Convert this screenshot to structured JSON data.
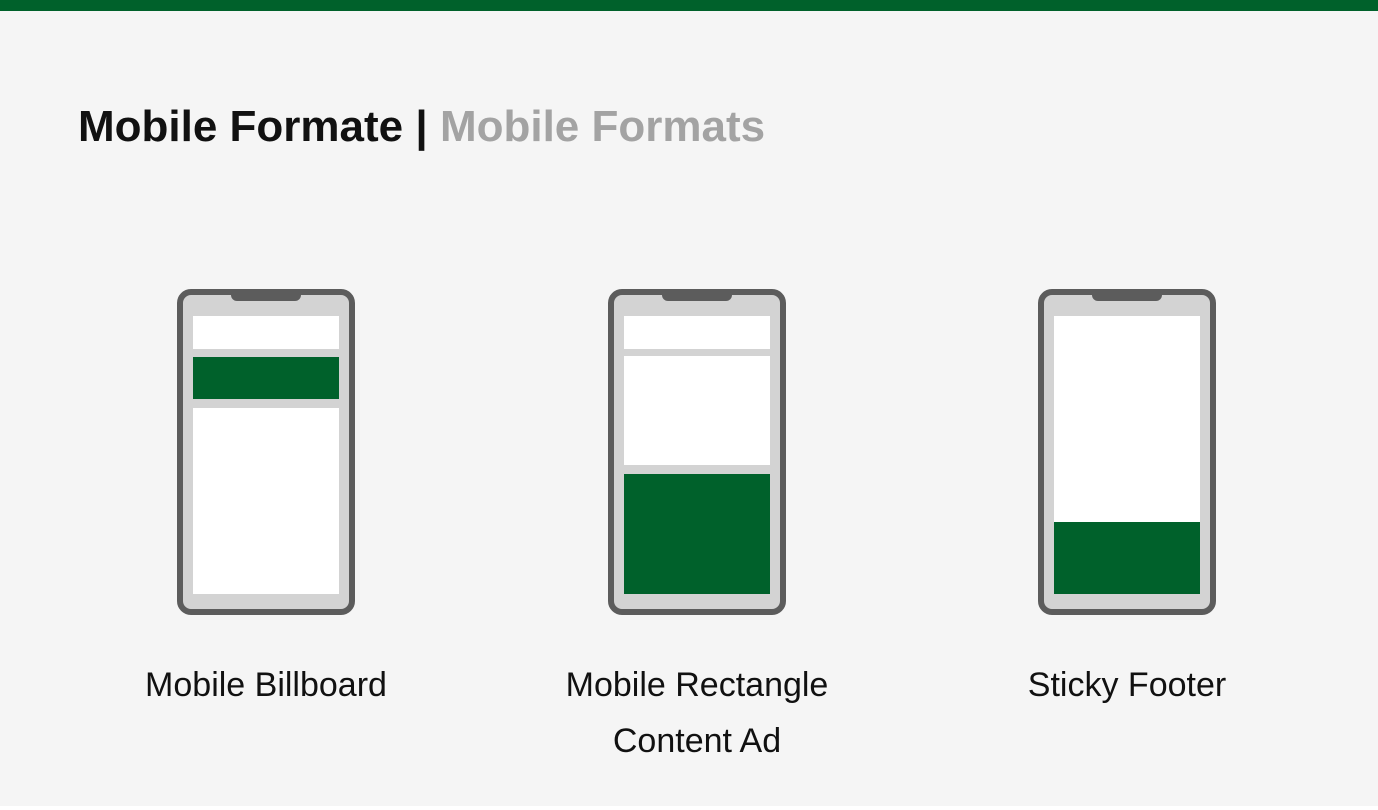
{
  "title": {
    "german": "Mobile Formate",
    "separator": "|",
    "english": "Mobile Formats"
  },
  "colors": {
    "accent_green": "#00612b",
    "phone_frame": "#5c5c5c",
    "phone_bezel": "#d3d3d3",
    "screen": "#ffffff",
    "secondary_text": "#a3a3a3"
  },
  "formats": [
    {
      "label": "Mobile Billboard",
      "ad_position": "top banner"
    },
    {
      "label_line1": "Mobile Rectangle",
      "label_line2": "Content Ad",
      "ad_position": "in-content rectangle"
    },
    {
      "label": "Sticky Footer",
      "ad_position": "bottom"
    }
  ]
}
